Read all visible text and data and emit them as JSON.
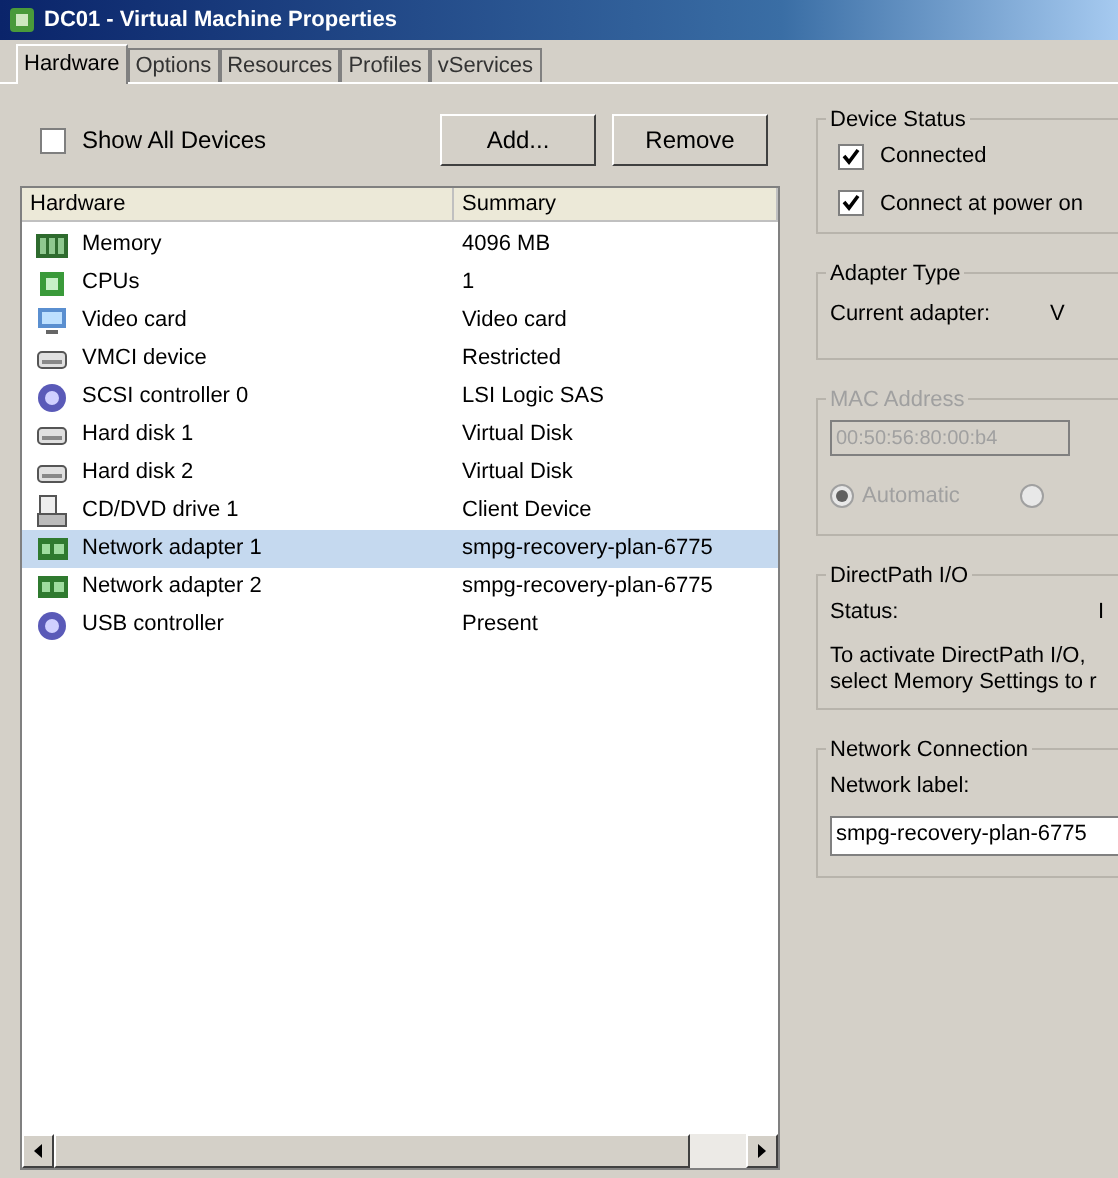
{
  "window": {
    "title": "DC01 - Virtual Machine Properties"
  },
  "tabs": [
    {
      "label": "Hardware",
      "selected": true
    },
    {
      "label": "Options",
      "selected": false
    },
    {
      "label": "Resources",
      "selected": false
    },
    {
      "label": "Profiles",
      "selected": false
    },
    {
      "label": "vServices",
      "selected": false
    }
  ],
  "show_all_devices": {
    "label": "Show All Devices",
    "checked": false
  },
  "buttons": [
    "Add...",
    "Remove"
  ],
  "table": {
    "columns": [
      "Hardware",
      "Summary"
    ],
    "rows": [
      {
        "kind": "memory",
        "name": "Memory",
        "summary": "4096 MB",
        "selected": false
      },
      {
        "kind": "cpu",
        "name": "CPUs",
        "summary": "1",
        "selected": false
      },
      {
        "kind": "video",
        "name": "Video card",
        "summary": "Video card",
        "selected": false
      },
      {
        "kind": "device",
        "name": "VMCI device",
        "summary": "Restricted",
        "selected": false
      },
      {
        "kind": "controller",
        "name": "SCSI controller 0",
        "summary": "LSI Logic SAS",
        "selected": false
      },
      {
        "kind": "device",
        "name": "Hard disk 1",
        "summary": "Virtual Disk",
        "selected": false
      },
      {
        "kind": "device",
        "name": "Hard disk 2",
        "summary": "Virtual Disk",
        "selected": false
      },
      {
        "kind": "cdrom",
        "name": "CD/DVD drive 1",
        "summary": "Client Device",
        "selected": false
      },
      {
        "kind": "network",
        "name": "Network adapter 1",
        "summary": "smpg-recovery-plan-6775",
        "selected": true
      },
      {
        "kind": "network",
        "name": "Network adapter 2",
        "summary": "smpg-recovery-plan-6775",
        "selected": false
      },
      {
        "kind": "controller",
        "name": "USB controller",
        "summary": "Present",
        "selected": false
      }
    ]
  },
  "device_status": {
    "title": "Device Status",
    "options": [
      {
        "label": "Connected",
        "checked": true
      },
      {
        "label": "Connect at power on",
        "checked": true
      }
    ]
  },
  "adapter_type": {
    "title": "Adapter Type",
    "label": "Current adapter:",
    "value": "V"
  },
  "mac_address": {
    "title": "MAC Address",
    "disabled": true,
    "value": "00:50:56:80:00:b4",
    "options": [
      {
        "label": "Automatic",
        "selected": true
      },
      {
        "selected": false
      }
    ]
  },
  "directpath": {
    "title": "DirectPath I/O",
    "label": "Status:",
    "value": "I",
    "note": [
      "To activate DirectPath I/O,",
      "select Memory Settings to r"
    ]
  },
  "network_connection": {
    "title": "Network Connection",
    "label": "Network label:",
    "value": "smpg-recovery-plan-6775"
  }
}
